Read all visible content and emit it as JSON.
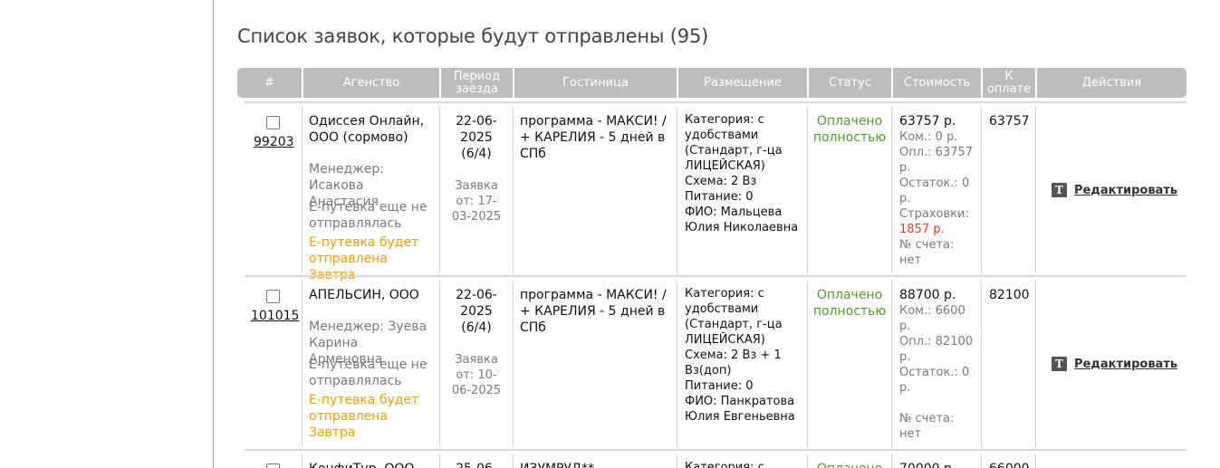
{
  "page_title": "Список заявок, которые будут отправлены (95)",
  "columns": [
    "#",
    "Агенство",
    "Период заезда",
    "Гостиница",
    "Размещение",
    "Статус",
    "Стоимость",
    "К оплате",
    "Действия"
  ],
  "rows": [
    {
      "id": "99203",
      "agency": "Одиссея Онлайн, ООО (сормово)",
      "manager": "Менеджер: Исакова Анастасия",
      "epass_status": "Е-путевка еще не отправлялась",
      "epass_plan": "Е-путевка будет отправлена Завтра",
      "period": "22-06-2025 (6/4)",
      "order_date": "Заявка от: 17-03-2025",
      "hotel": "программа - МАКСИ! / + КАРЕЛИЯ - 5 дней в СПб",
      "placement": "Категория: с удобствами (Стандарт, г-ца ЛИЦЕЙСКАЯ)\nСхема: 2 Вз\nПитание: 0\nФИО: Мальцева Юлия Николаевна",
      "status": "Оплачено полностью",
      "cost_main": "63757 р.",
      "cost_details": "Ком.: 0 р.\nОпл.: 63757 р.\nОстаток.: 0 р.\nСтраховки:",
      "insurance": "1857 р.",
      "account": "№ счета: нет",
      "to_pay": "63757",
      "action": "Редактировать"
    },
    {
      "id": "101015",
      "agency": "АПЕЛЬСИН, ООО",
      "manager": "Менеджер: Зуева Карина Арменовна",
      "epass_status": "Е-путевка еще не отправлялась",
      "epass_plan": "Е-путевка будет отправлена Завтра",
      "period": "22-06-2025 (6/4)",
      "order_date": "Заявка от: 10-06-2025",
      "hotel": "программа - МАКСИ! / + КАРЕЛИЯ - 5 дней в СПб",
      "placement": "Категория: с удобствами (Стандарт, г-ца ЛИЦЕЙСКАЯ)\nСхема: 2 Вз + 1 Вз(доп)\nПитание: 0\nФИО: Панкратова Юлия Евгеньевна",
      "status": "Оплачено полностью",
      "cost_main": "88700 р.",
      "cost_details": "Ком.: 6600 р.\nОпл.: 82100 р.\nОстаток.: 0 р.",
      "account": "№ счета: нет",
      "to_pay": "82100",
      "action": "Редактировать"
    },
    {
      "agency": "КонфиТур, ООО",
      "period": "25-06-",
      "hotel": "ИЗУМРУД**",
      "placement": "Категория: с",
      "status": "Оплачено",
      "cost_main": "70000 р.",
      "to_pay": "66000"
    }
  ]
}
